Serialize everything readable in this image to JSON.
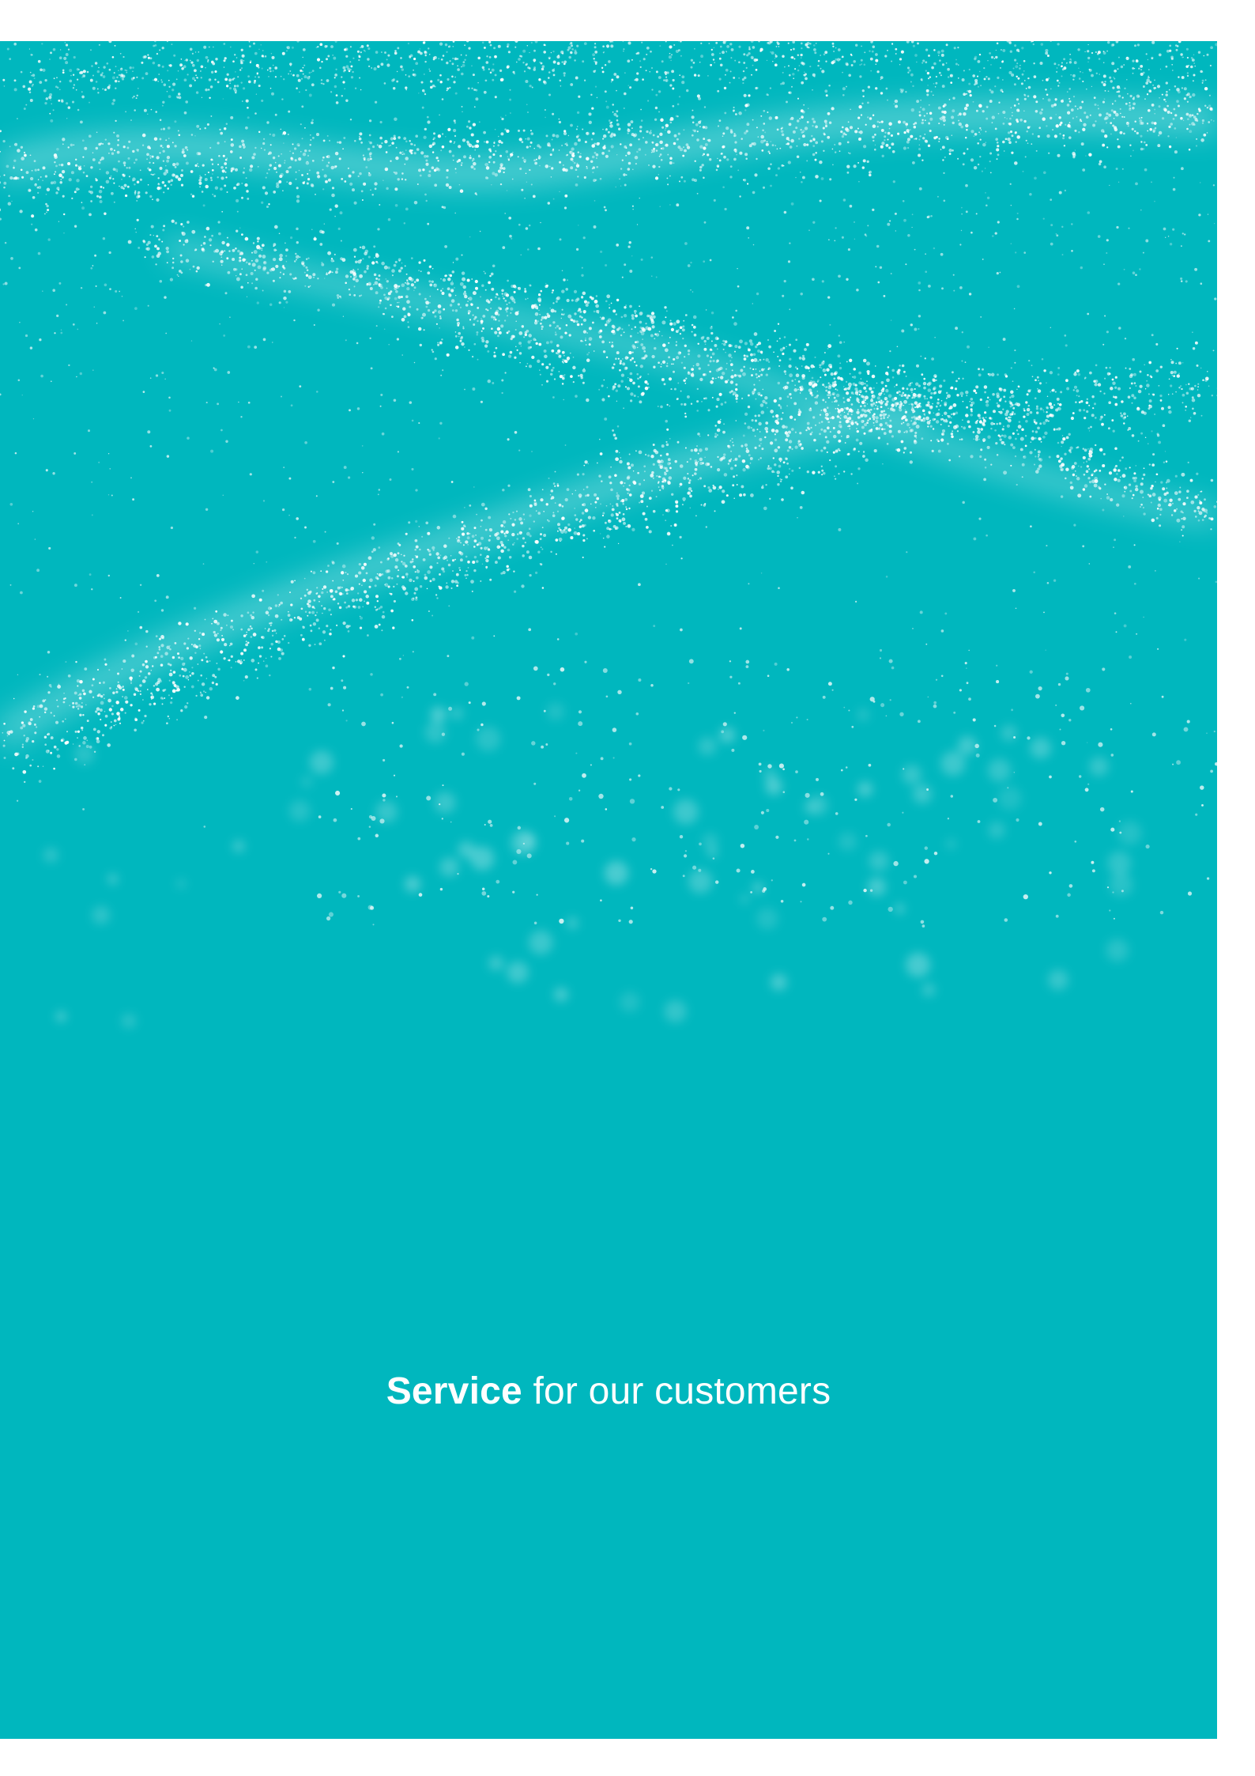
{
  "colors": {
    "panel_background": "#00b7be",
    "particle_color": "#ffffff",
    "page_background": "#ffffff"
  },
  "cover": {
    "headline_emphasis": "Service",
    "headline_rest": " for our customers"
  },
  "visuals": {
    "background_art": "white particle waves over teal",
    "icons": []
  }
}
